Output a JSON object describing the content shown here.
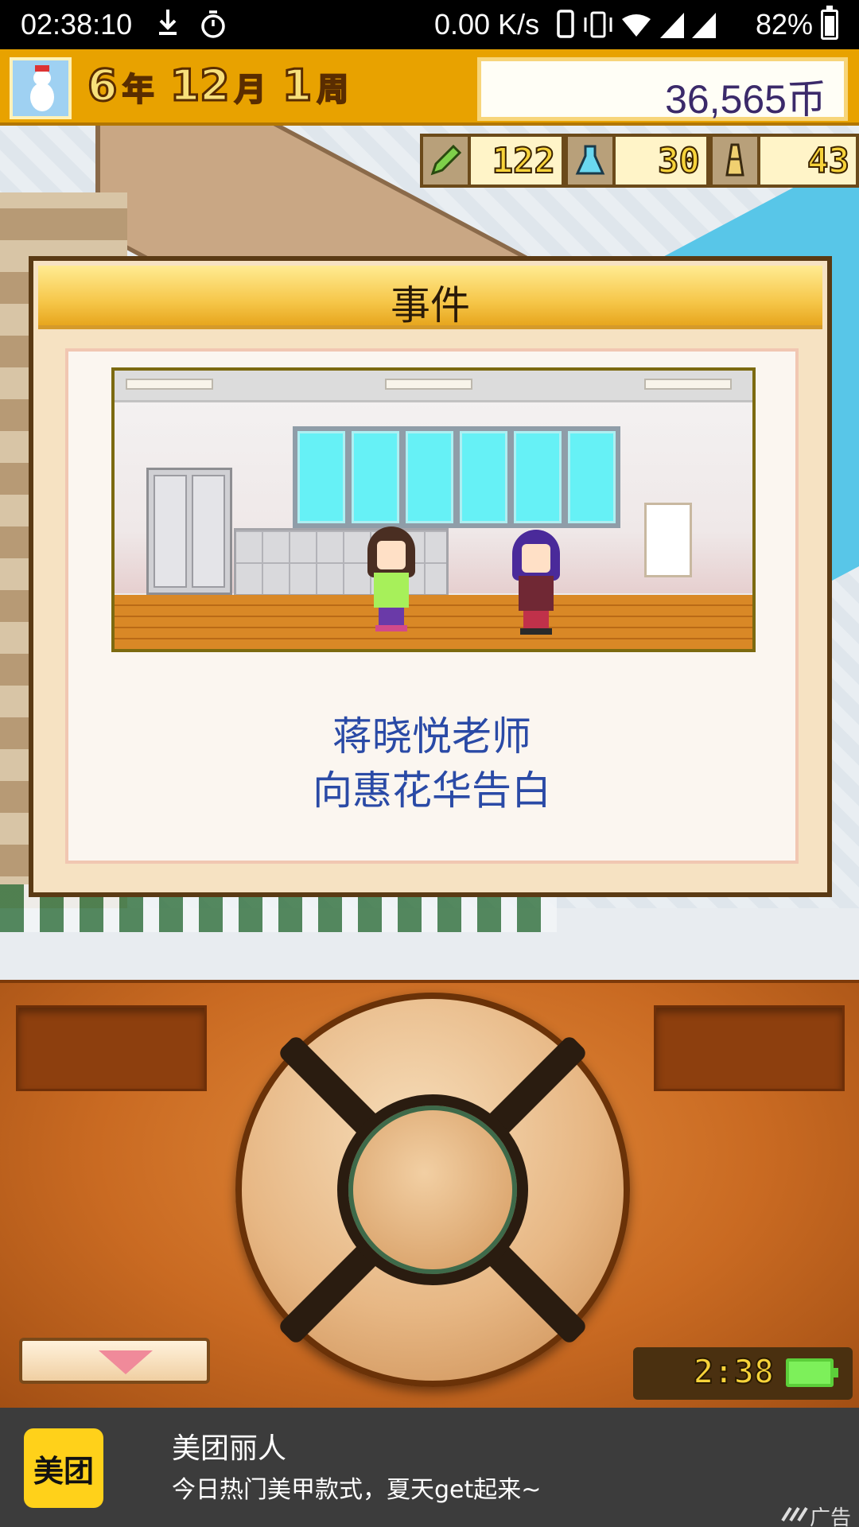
{
  "status_bar": {
    "time": "02:38:10",
    "net_speed": "0.00 K/s",
    "battery_percent": "82%",
    "icons": [
      "download-icon",
      "timer-icon",
      "phone-icon",
      "vibrate-icon",
      "wifi-icon",
      "signal-icon",
      "signal-icon",
      "battery-icon"
    ]
  },
  "hud": {
    "year_num": "6",
    "year_unit": "年",
    "month_num": "12",
    "month_unit": "月",
    "week_num": "1",
    "week_unit": "周",
    "money": "36,565币",
    "portrait_icon": "snowman-icon"
  },
  "resources": {
    "pencil": "122",
    "flask": "30",
    "tower": "43"
  },
  "dialog": {
    "title": "事件",
    "line1": "蒋晓悦老师",
    "line2": "向惠花华告白"
  },
  "controller": {
    "clock": "2:38"
  },
  "ad": {
    "logo": "美团",
    "title": "美团丽人",
    "desc": "今日热门美甲款式，夏天get起来~",
    "label": "广告"
  },
  "colors": {
    "hud_bg": "#e8a200",
    "dialog_header": "#f6c74a",
    "event_text": "#2a4aa6",
    "panel": "#c96a22",
    "ad_logo": "#ffd11a"
  }
}
